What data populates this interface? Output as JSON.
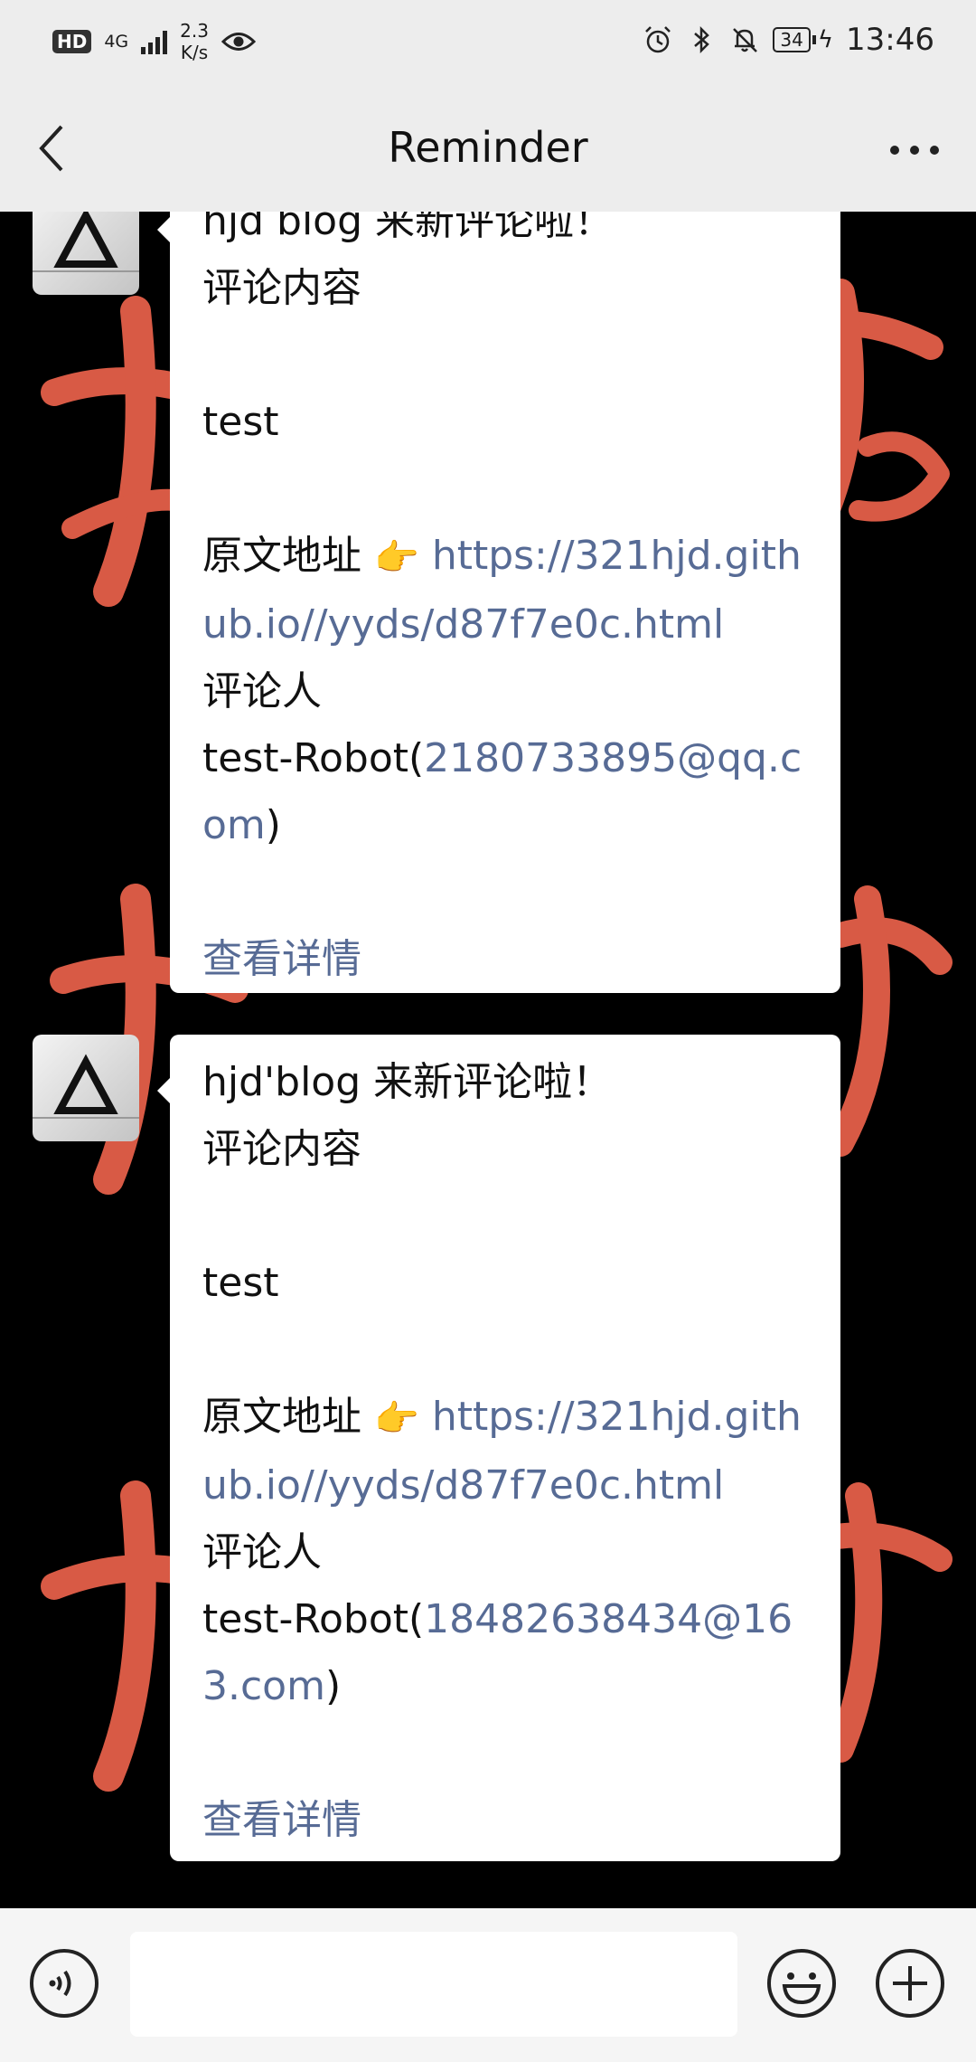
{
  "status_bar": {
    "hd_badge": "HD",
    "network": "4G",
    "speed_value": "2.3",
    "speed_unit": "K/s",
    "battery": "34",
    "time": "13:46"
  },
  "header": {
    "title": "Reminder"
  },
  "messages": [
    {
      "line1": "hjd blog 来新评论啦！",
      "line2": "评论内容",
      "line3": "test",
      "source_label": "原文地址",
      "pointer": "👉",
      "url": "https://321hjd.github.io//yyds/d87f7e0c.html",
      "commenter_label": "评论人",
      "commenter_name": "test-Robot(",
      "commenter_email": "2180733895@qq.com",
      "commenter_close": ")",
      "detail_link": "查看详情"
    },
    {
      "line1": "hjd'blog 来新评论啦！",
      "line2": "评论内容",
      "line3": "test",
      "source_label": "原文地址",
      "pointer": "👉",
      "url": "https://321hjd.github.io//yyds/d87f7e0c.html",
      "commenter_label": "评论人",
      "commenter_name": "test-Robot(",
      "commenter_email": "18482638434@163.com",
      "commenter_close": ")",
      "detail_link": "查看详情"
    }
  ],
  "icons": {
    "back": "back-arrow-icon",
    "more": "more-icon",
    "voice": "voice-icon",
    "emoji": "emoji-icon",
    "plus": "plus-icon"
  },
  "colors": {
    "link": "#576b95",
    "chat_background": "#000000",
    "calligraphy": "#d85a45",
    "header_background": "#ededed"
  }
}
